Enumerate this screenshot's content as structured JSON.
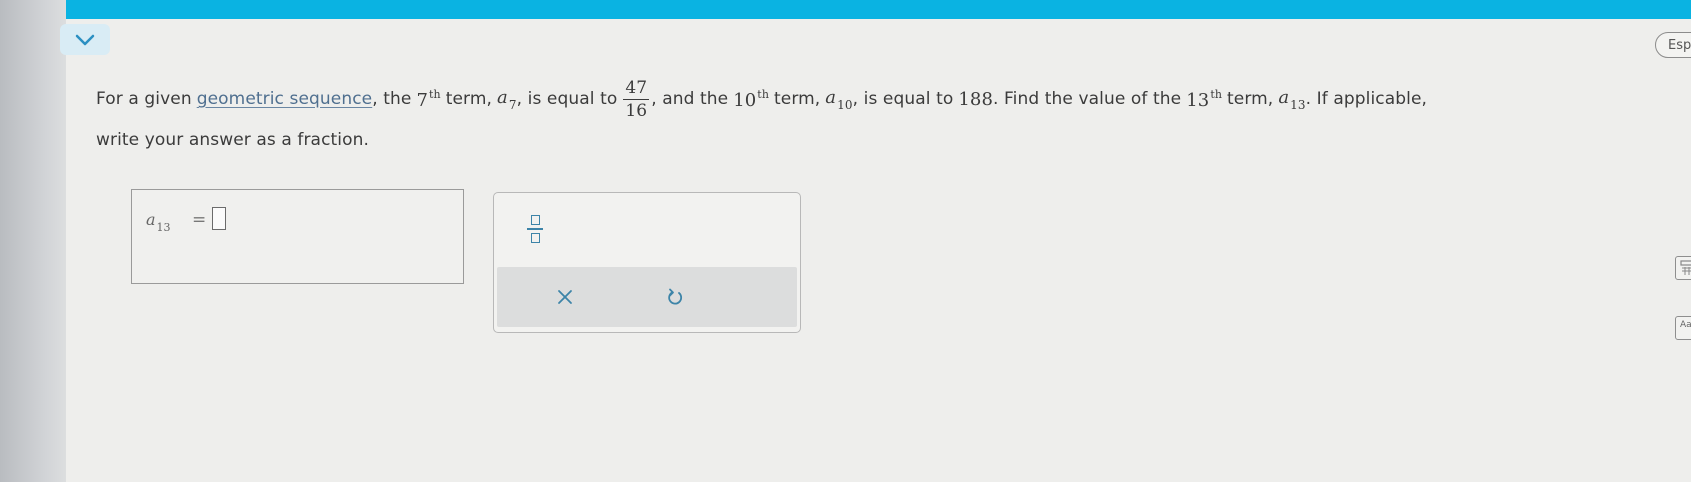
{
  "header": {
    "accent_color": "#0ab3e2",
    "collapse_icon": "chevron-down-icon",
    "language_button": "Esp"
  },
  "question": {
    "part1": "For a given",
    "link_text": "geometric sequence",
    "part2": ", the",
    "n7": "7",
    "th": "th",
    "term_word": "term,",
    "var_a": "a",
    "sub7": "7",
    "part3": ", is equal to",
    "frac_num": "47",
    "frac_den": "16",
    "part4": ", and the",
    "n10": "10",
    "sub10": "10",
    "part5": ", is equal to",
    "value188": "188",
    "part6": ". Find the value of the",
    "n13": "13",
    "sub13": "13",
    "part7": ". If applicable,",
    "line2": "write your answer as a fraction."
  },
  "answer": {
    "var": "a",
    "sub": "13",
    "equals": "=",
    "value": ""
  },
  "toolbar": {
    "fraction_icon": "fraction-icon",
    "clear_icon": "close-icon",
    "undo_icon": "undo-icon",
    "icon_color": "#3d84a8"
  },
  "side_tools": {
    "calculator_icon": "calculator-icon",
    "text_icon": "text-size-icon",
    "text_icon_label": "Aa"
  }
}
